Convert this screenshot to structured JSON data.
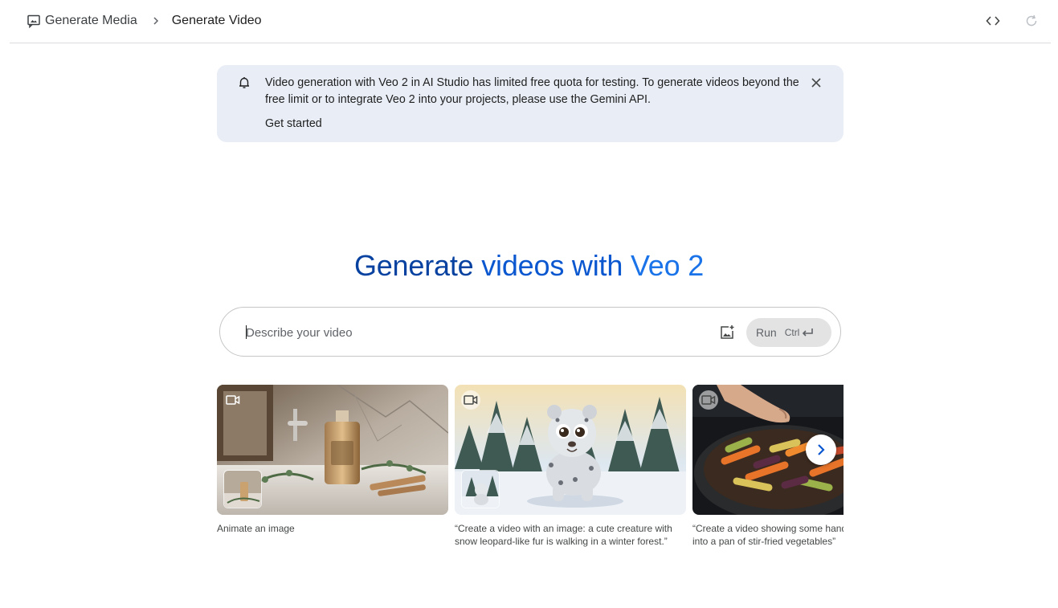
{
  "header": {
    "breadcrumb_root": "Generate Media",
    "breadcrumb_current": "Generate Video",
    "icons": [
      "chat-image-icon",
      "chevron-right-icon",
      "code-icon",
      "refresh-icon"
    ]
  },
  "banner": {
    "message": "Video generation with Veo 2 in AI Studio has limited free quota for testing. To generate videos beyond the free limit or to integrate Veo 2 into your projects, please use the Gemini API.",
    "link_label": "Get started",
    "icons": [
      "bell-icon",
      "close-icon"
    ],
    "background": "#e8edf6"
  },
  "hero": {
    "title_part1": "Generate",
    "title_part2": "videos with",
    "title_part3": "Veo 2"
  },
  "prompt": {
    "placeholder": "Describe your video",
    "value": "",
    "run_label": "Run",
    "shortcut_label": "Ctrl"
  },
  "examples": [
    {
      "caption": "Animate an image",
      "scene": "perfume bottle on marble counter"
    },
    {
      "caption": "“Create a video with an image: a cute creature with snow leopard-like fur is walking in a winter forest.”",
      "scene": "snow leopard cub in winter forest"
    },
    {
      "caption": "“Create a video showing some hand sprinkling salt into a pan of stir-fried vegetables”",
      "scene": "hand over cast iron pan of vegetables"
    }
  ],
  "colors": {
    "accent": "#0b57d0",
    "title_dark": "#0842a0",
    "run_bg": "#e3e3e3"
  }
}
